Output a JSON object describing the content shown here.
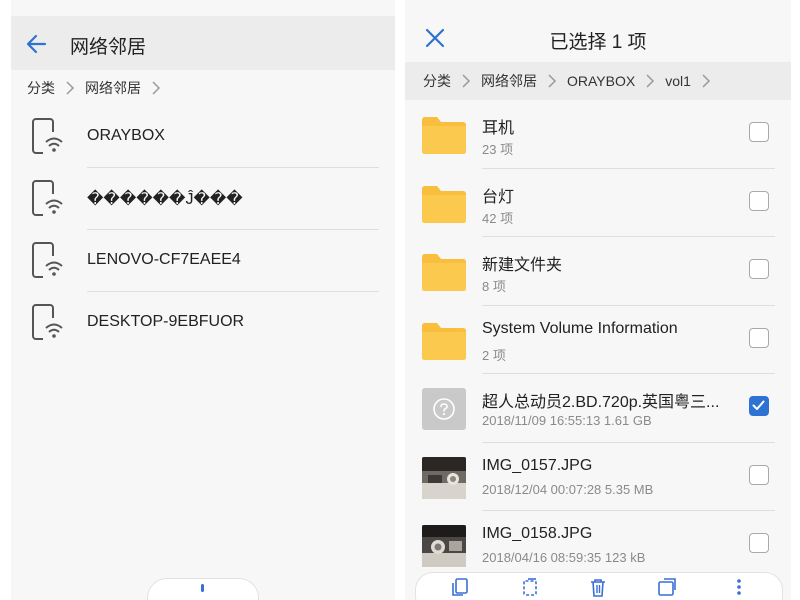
{
  "left": {
    "title": "网络邻居",
    "breadcrumb": [
      "分类",
      "网络邻居"
    ],
    "devices": [
      {
        "name": "ORAYBOX"
      },
      {
        "name": "������Ĵ���"
      },
      {
        "name": "LENOVO-CF7EAEE4"
      },
      {
        "name": "DESKTOP-9EBFUOR"
      }
    ],
    "icons": {
      "back": "back-arrow-icon",
      "device": "network-device-icon",
      "chevron": "chevron-right-icon"
    }
  },
  "right": {
    "title": "已选择 1 项",
    "breadcrumb": [
      "分类",
      "网络邻居",
      "ORAYBOX",
      "vol1"
    ],
    "files": [
      {
        "name": "耳机",
        "meta": "23 项",
        "type": "folder",
        "checked": false
      },
      {
        "name": "台灯",
        "meta": "42 项",
        "type": "folder",
        "checked": false
      },
      {
        "name": "新建文件夹",
        "meta": "8 项",
        "type": "folder",
        "checked": false
      },
      {
        "name": "System Volume Information",
        "meta": "2 项",
        "type": "folder",
        "checked": false
      },
      {
        "name": "超人总动员2.BD.720p.英国粤三...",
        "meta": "2018/11/09 16:55:13 1.61 GB",
        "type": "unknown",
        "checked": true
      },
      {
        "name": "IMG_0157.JPG",
        "meta": "2018/12/04 00:07:28 5.35 MB",
        "type": "image",
        "checked": false
      },
      {
        "name": "IMG_0158.JPG",
        "meta": "2018/04/16 08:59:35 123 kB",
        "type": "image",
        "checked": false
      }
    ],
    "icons": {
      "close": "close-icon",
      "folder": "folder-icon",
      "unknown": "unknown-file-icon",
      "image": "image-thumbnail",
      "toolbar": [
        "copy-icon",
        "move-icon",
        "delete-icon",
        "share-icon",
        "more-icon"
      ]
    }
  },
  "colors": {
    "accent": "#2e72d2",
    "folder": "#f9be3d",
    "background": "#f7f7f7",
    "header": "#ececec"
  }
}
